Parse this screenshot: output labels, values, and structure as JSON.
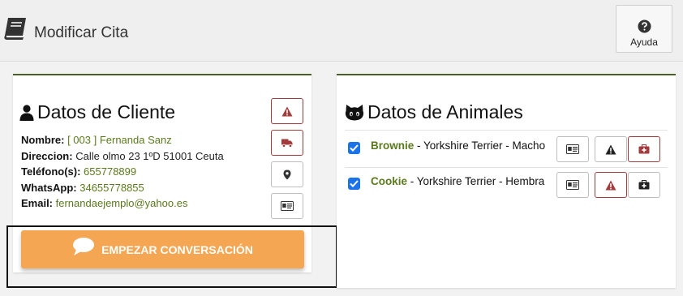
{
  "header": {
    "title": "Modificar Cita",
    "help_label": "Ayuda",
    "book_icon": "book-icon",
    "help_icon": "question-circle-icon"
  },
  "client": {
    "title": "Datos de Cliente",
    "fields": [
      {
        "label": "Nombre:",
        "value": "[ 003 ] Fernanda Sanz",
        "highlight": true
      },
      {
        "label": "Direccion:",
        "value": "Calle olmo 23 1ºD   51001  Ceuta",
        "highlight": false
      },
      {
        "label": "Teléfono(s):",
        "value": "655778899",
        "highlight": true
      },
      {
        "label": "WhatsApp:",
        "value": "34655778855",
        "highlight": true
      },
      {
        "label": "Email:",
        "value": "fernandaejemplo@yahoo.es",
        "highlight": true
      }
    ],
    "actions": [
      "warning-icon",
      "truck-icon",
      "location-pin-icon",
      "id-card-icon"
    ],
    "chat_button": "EMPEZAR CONVERSACIÓN"
  },
  "animals": {
    "title": "Datos de Animales",
    "items": [
      {
        "name": "Brownie",
        "details": " - Yorkshire Terrier - Macho",
        "checked": true
      },
      {
        "name": "Cookie",
        "details": " - Yorkshire Terrier - Hembra",
        "checked": true
      }
    ]
  },
  "colors": {
    "accent_green": "#5b7a1e",
    "panel_border": "#4a5e25",
    "alert_red": "#a23b3b",
    "chat_orange": "#f5a653",
    "checkbox_blue": "#1a73e8"
  }
}
